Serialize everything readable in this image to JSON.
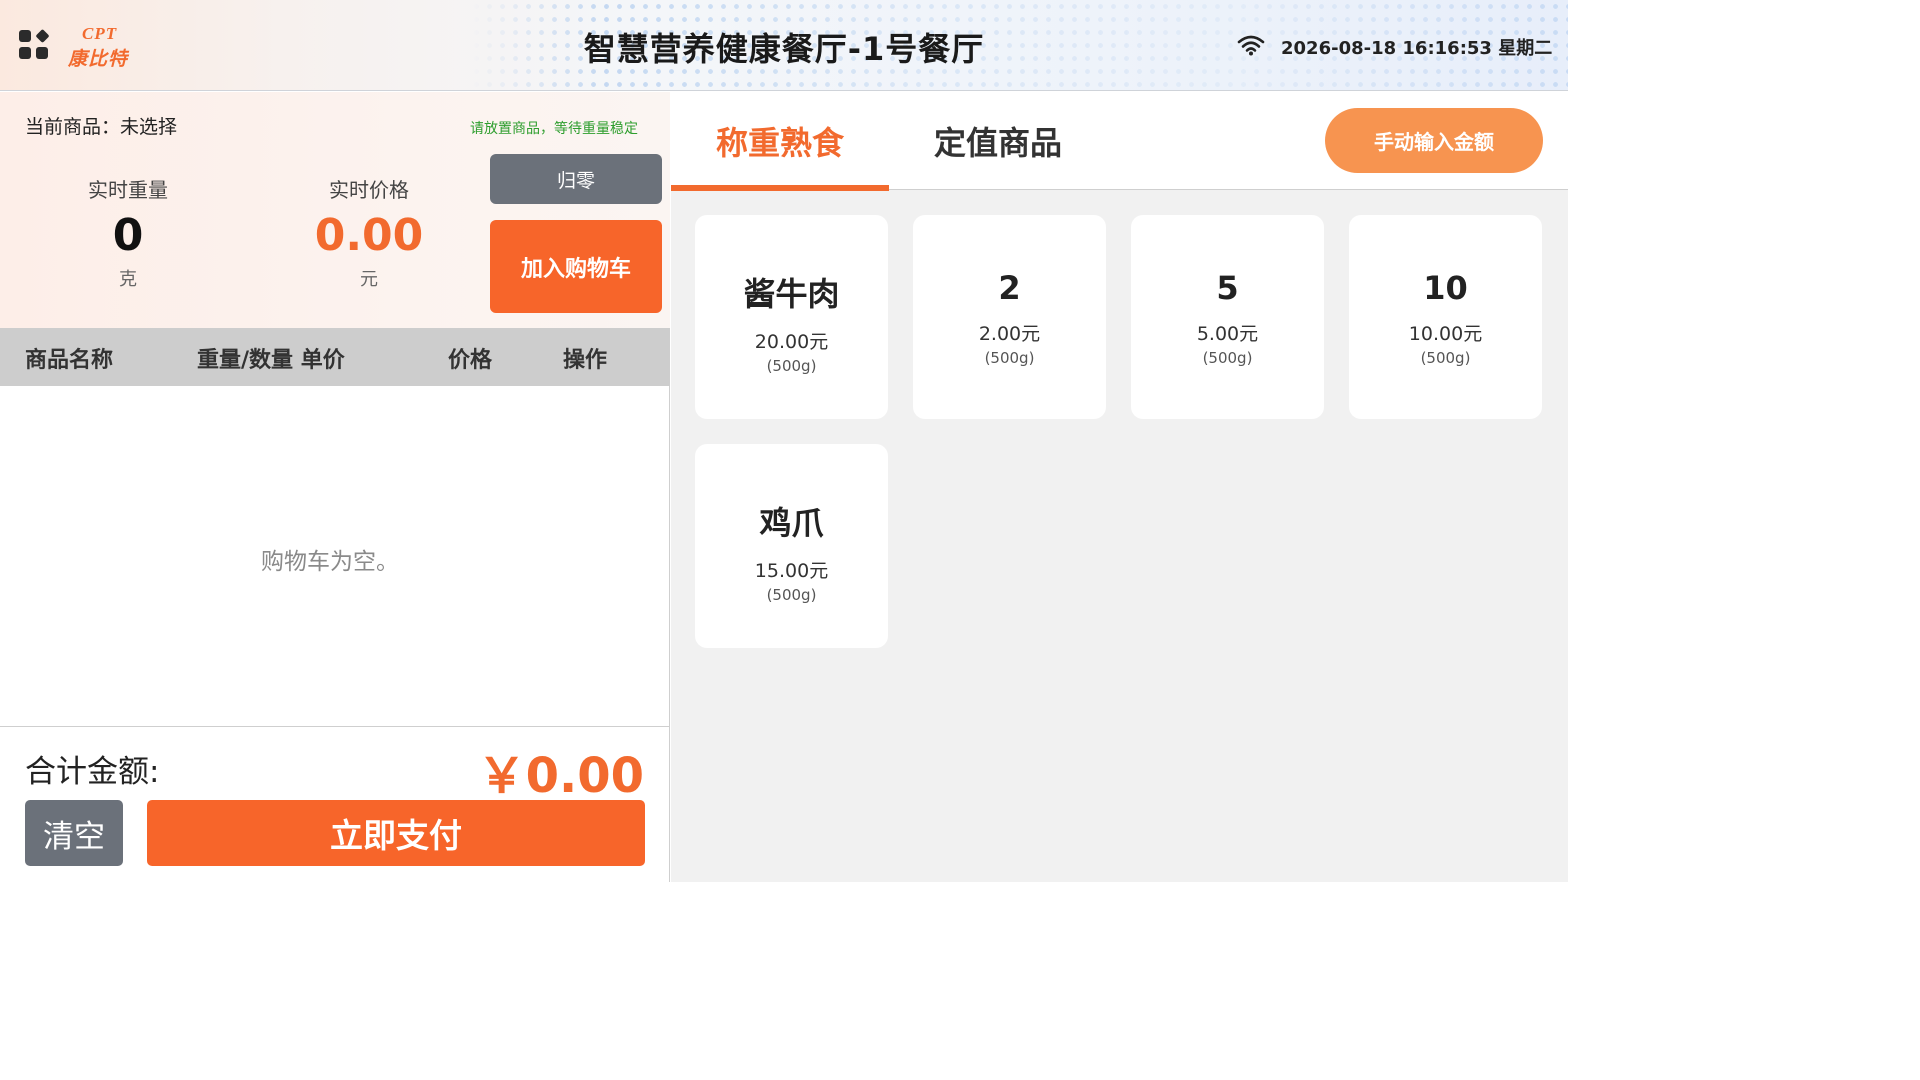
{
  "header": {
    "logo_top": "CPT",
    "logo_bottom": "康比特",
    "title": "智慧营养健康餐厅-1号餐厅",
    "datetime": "2026-08-18 16:16:53 星期二",
    "icons": {
      "menu": "apps-grid-icon",
      "wifi": "wifi-icon"
    }
  },
  "scale": {
    "current_product": "当前商品：未选择",
    "hint": "请放置商品，等待重量稳定",
    "weight_label": "实时重量",
    "weight_value": "0",
    "weight_unit": "克",
    "price_label": "实时价格",
    "price_value": "0.00",
    "price_unit": "元",
    "zero_label": "归零",
    "add_cart_label": "加入购物车"
  },
  "cart": {
    "columns": [
      "商品名称",
      "重量/数量 单价",
      "价格",
      "操作"
    ],
    "empty_text": "购物车为空。",
    "total_label": "合计金额:",
    "total_value": "￥0.00",
    "clear_label": "清空",
    "pay_label": "立即支付"
  },
  "tabs": {
    "items": [
      "称重熟食",
      "定值商品"
    ],
    "active_index": 0,
    "manual_label": "手动输入金额"
  },
  "products": [
    {
      "name": "酱牛肉",
      "price": "20.00元",
      "unit": "(500g)"
    },
    {
      "name": "2",
      "price": "2.00元",
      "unit": "(500g)"
    },
    {
      "name": "5",
      "price": "5.00元",
      "unit": "(500g)"
    },
    {
      "name": "10",
      "price": "10.00元",
      "unit": "(500g)"
    },
    {
      "name": "鸡爪",
      "price": "15.00元",
      "unit": "(500g)"
    }
  ],
  "colors": {
    "accent": "#f7652a",
    "accent_text": "#f26a2e",
    "manual_button": "#f79450",
    "gray_button": "#6b717a",
    "hint_green": "#2e9e2e"
  }
}
